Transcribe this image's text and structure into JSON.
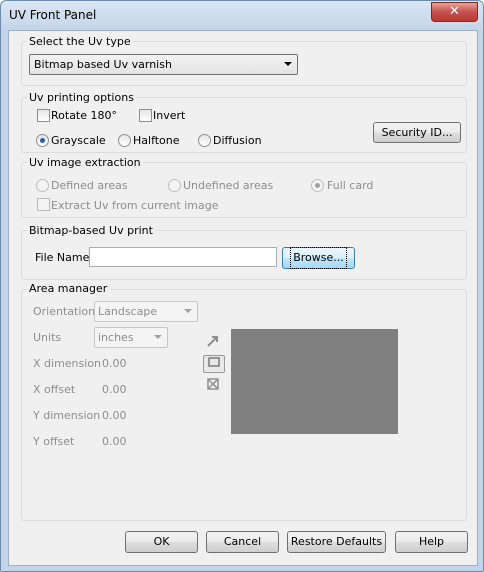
{
  "window": {
    "title": "UV Front Panel",
    "close": "✕"
  },
  "uv_type": {
    "label": "Select the Uv type",
    "selected": "Bitmap based Uv varnish"
  },
  "printing_options": {
    "label": "Uv printing options",
    "rotate": "Rotate 180°",
    "invert": "Invert",
    "grayscale": "Grayscale",
    "halftone": "Halftone",
    "diffusion": "Diffusion",
    "security_button": "Security ID..."
  },
  "extraction": {
    "label": "Uv image extraction",
    "defined": "Defined areas",
    "undefined": "Undefined areas",
    "full_card": "Full card",
    "extract": "Extract Uv from current image"
  },
  "bitmap_print": {
    "label": "Bitmap-based Uv print",
    "file_label": "File Name",
    "file_value": "",
    "browse_button": "Browse..."
  },
  "area_manager": {
    "label": "Area manager",
    "orientation_label": "Orientation",
    "orientation_value": "Landscape",
    "units_label": "Units",
    "units_value": "inches",
    "x_dim_label": "X dimension",
    "x_dim_value": "0.00",
    "x_off_label": "X offset",
    "x_off_value": "0.00",
    "y_dim_label": "Y dimension",
    "y_dim_value": "0.00",
    "y_off_label": "Y offset",
    "y_off_value": "0.00",
    "tools": [
      "pointer-arrow-icon",
      "rectangle-icon",
      "delete-area-icon"
    ],
    "preview_color": "#808080"
  },
  "footer": {
    "ok": "OK",
    "cancel": "Cancel",
    "restore": "Restore Defaults",
    "help": "Help"
  }
}
